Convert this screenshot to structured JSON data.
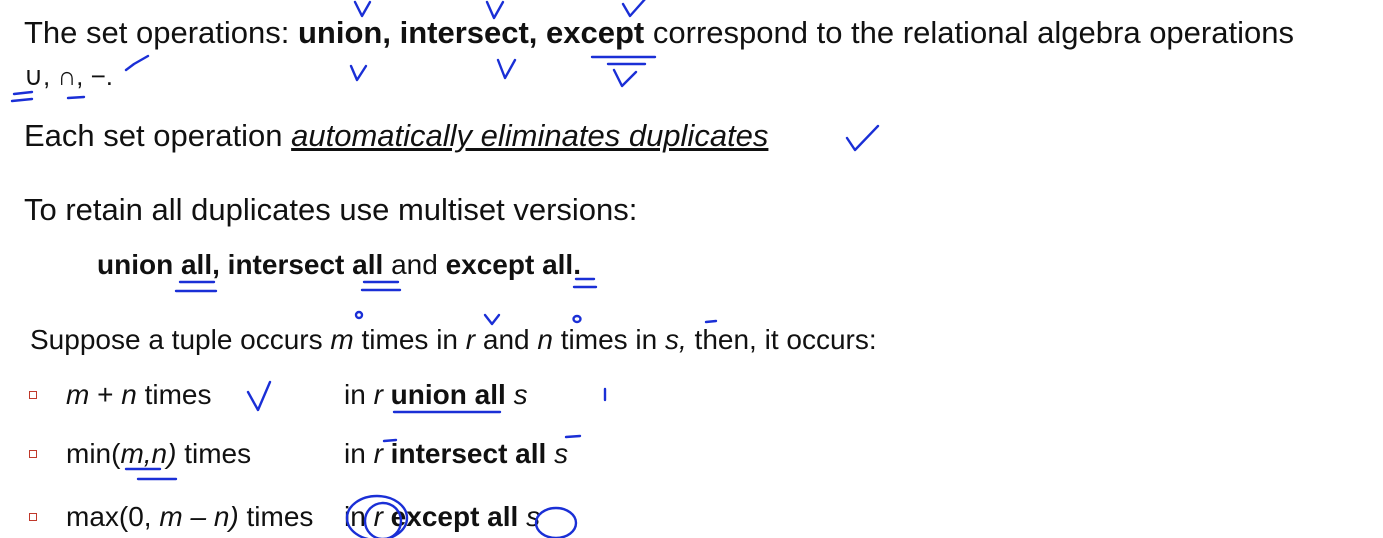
{
  "line1": {
    "prefix": "The set operations: ",
    "ops": "union, intersect, except",
    "suffix": " correspond to the relational algebra operations"
  },
  "line2": {
    "symbols": "∪, ∩, −."
  },
  "line3": {
    "prefix": "Each set operation ",
    "emphasis": "automatically eliminates duplicates"
  },
  "line4": {
    "text": "To retain all duplicates use multiset versions:"
  },
  "line5": {
    "a": "union all, intersect all",
    "and": " and ",
    "b": "except all."
  },
  "line6": {
    "t1": "Suppose a tuple occurs ",
    "m": "m",
    "t2": " times in ",
    "r": "r",
    "t3": " and ",
    "n": "n",
    "t4": " times in ",
    "s": "s,",
    "t5": " then, it occurs:"
  },
  "rows": [
    {
      "count": [
        {
          "t": "m",
          "i": true
        },
        {
          "t": "  + ",
          "i": false
        },
        {
          "t": "n",
          "i": true
        },
        {
          "t": " times",
          "i": false
        }
      ],
      "pre": "in ",
      "r": "r",
      "op": " union all ",
      "s": "s"
    },
    {
      "count": [
        {
          "t": "min(",
          "i": false
        },
        {
          "t": "m,n)",
          "i": true
        },
        {
          "t": " times",
          "i": false
        }
      ],
      "pre": "in ",
      "r": "r",
      "op": " intersect all ",
      "s": "s"
    },
    {
      "count": [
        {
          "t": "max(0, ",
          "i": false
        },
        {
          "t": "m – n)",
          "i": true
        },
        {
          "t": " times",
          "i": false
        }
      ],
      "pre": "in ",
      "r": "r",
      "op": " except all ",
      "s": "s"
    }
  ],
  "colors": {
    "ink": "#1a2fd6",
    "bullet": "#c0392b",
    "text": "#111111"
  }
}
